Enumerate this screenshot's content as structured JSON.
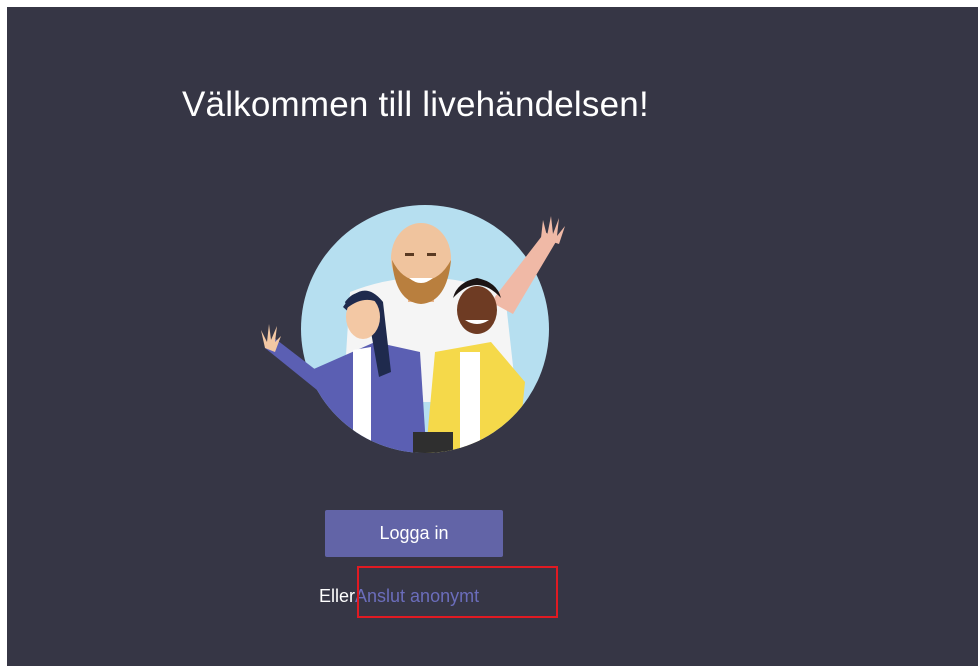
{
  "page": {
    "title": "Välkommen till livehändelsen!"
  },
  "actions": {
    "signin_label": "Logga in",
    "or_label": "Eller",
    "anonymous_label": "Anslut anonymt"
  },
  "colors": {
    "background": "#363645",
    "primary_button": "#6264a7",
    "link": "#6b6dbb",
    "highlight": "#e01a22"
  },
  "illustration": {
    "icon": "welcome-people-illustration"
  }
}
